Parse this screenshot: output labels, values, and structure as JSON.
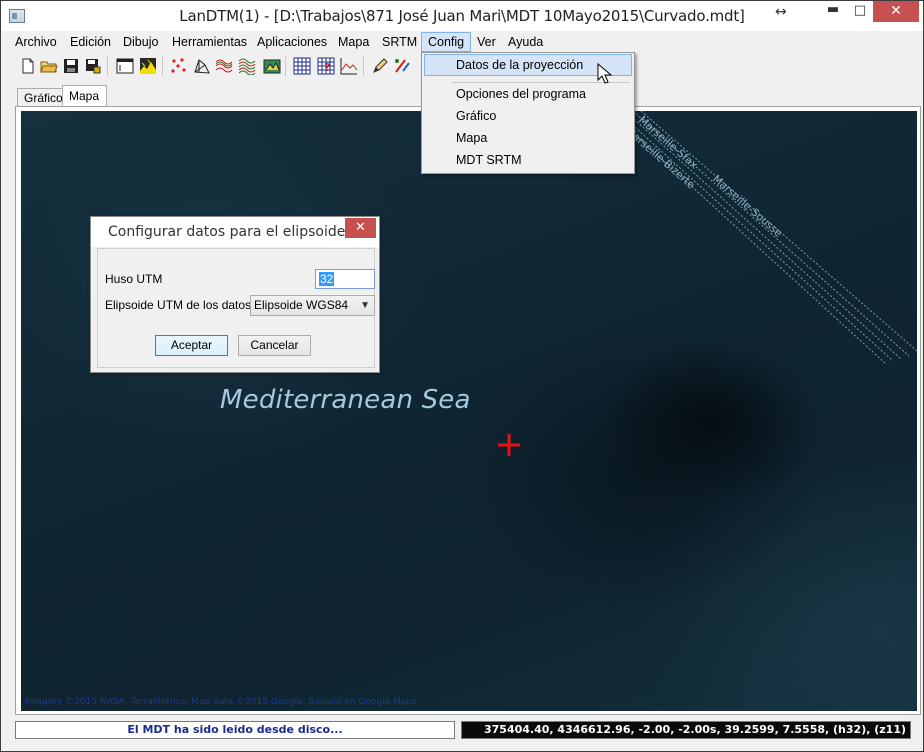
{
  "window": {
    "title": "LanDTM(1) - [D:\\Trabajos\\871 José Juan Mari\\MDT 10Mayo2015\\Curvado.mdt]",
    "resize_glyph": "↔",
    "minimize_glyph": "▬",
    "maximize_glyph": "□",
    "close_glyph": "✕"
  },
  "menubar": {
    "items": [
      "Archivo",
      "Edición",
      "Dibujo",
      "Herramientas",
      "Aplicaciones",
      "Mapa",
      "SRTM",
      "Config",
      "Ver",
      "Ayuda"
    ],
    "active": "Config"
  },
  "toolbar": {
    "icons": [
      "new-file-icon",
      "open-folder-icon",
      "save-icon",
      "save-as-icon",
      "window-icon",
      "terrain-icon",
      "points-icon",
      "mesh-icon",
      "contour-icon",
      "contour-alt-icon",
      "map-3d-icon",
      "grid-icon",
      "grid-query-icon",
      "profile-icon",
      "pencil-icon",
      "draw-tool-icon"
    ]
  },
  "tabs": [
    {
      "label": "Gráfico",
      "selected": false
    },
    {
      "label": "Mapa",
      "selected": true
    }
  ],
  "dropdown": {
    "items": [
      "Datos de la proyección",
      "Opciones del programa",
      "Gráfico",
      "Mapa",
      "MDT SRTM"
    ],
    "highlighted": "Datos de la proyección"
  },
  "map": {
    "sea_label": "Mediterranean Sea",
    "cable_labels": [
      "Marseille-Sfax",
      "Marseille-Bizerte",
      "Marseille-Sousse"
    ],
    "attribution": "Imagery ©2015 NASA, TerraMetrics, Map data ©2015 Google, Basado en Google Maps"
  },
  "dialog": {
    "title": "Configurar datos para el elipsoide",
    "close_glyph": "✕",
    "huso_label": "Huso UTM",
    "huso_value": "32",
    "elipsoide_label": "Elipsoide UTM de los datos",
    "elipsoide_value": "Elipsoide WGS84",
    "accept_label": "Aceptar",
    "cancel_label": "Cancelar"
  },
  "status": {
    "message": "El MDT ha sido leido desde disco...",
    "coordinates": "375404.40, 4346612.96, -2.00, -2.00s, 39.2599, 7.5558, (h32), (z11)"
  },
  "colors": {
    "map_background": "#12293a",
    "close_button": "#c75050",
    "menu_highlight": "#d5e5f7",
    "cursor_cross": "#e81010",
    "status_message_text": "#1a2a8c"
  }
}
